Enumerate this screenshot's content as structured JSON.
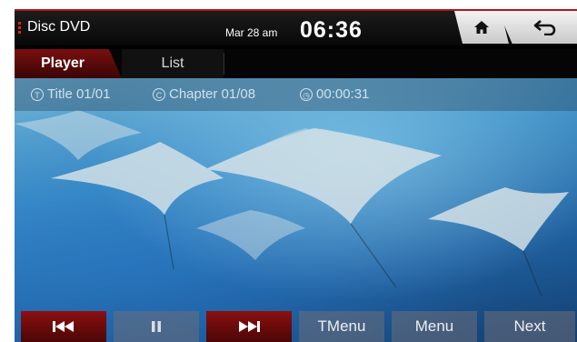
{
  "status_bar": {
    "app_title": "Disc DVD",
    "date": "Mar 28 am",
    "time": "06:36",
    "home_icon": "home-icon",
    "back_icon": "back-arrow-icon"
  },
  "tabs": [
    {
      "label": "Player",
      "active": true
    },
    {
      "label": "List",
      "active": false
    }
  ],
  "info": {
    "title": "Title 01/01",
    "chapter": "Chapter 01/08",
    "elapsed": "00:00:31"
  },
  "controls": {
    "prev_icon": "skip-previous-icon",
    "pause_icon": "pause-icon",
    "next_icon": "skip-next-icon",
    "tmenu": "TMenu",
    "menu": "Menu",
    "next": "Next"
  },
  "colors": {
    "accent": "#8a1010",
    "status_red": "#e02020"
  }
}
